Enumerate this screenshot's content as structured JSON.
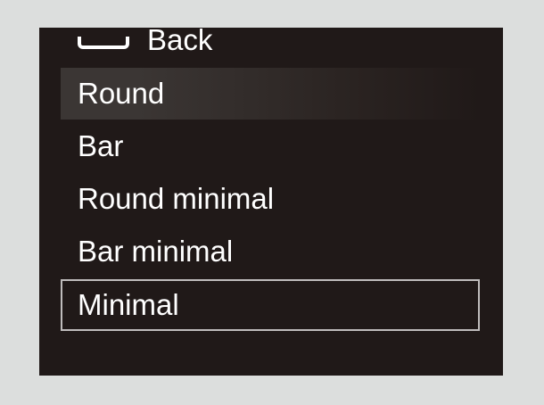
{
  "menu": {
    "back": {
      "label": "Back",
      "icon": "back-icon"
    },
    "items": [
      {
        "label": "Round",
        "state": "highlighted"
      },
      {
        "label": "Bar",
        "state": "normal"
      },
      {
        "label": "Round minimal",
        "state": "normal"
      },
      {
        "label": "Bar minimal",
        "state": "normal"
      },
      {
        "label": "Minimal",
        "state": "focused"
      }
    ]
  },
  "colors": {
    "page_background": "#dcdedd",
    "panel_background": "#201918",
    "text": "#ffffff",
    "highlight": "#3b3634",
    "focus_border": "#bfbcbc"
  }
}
